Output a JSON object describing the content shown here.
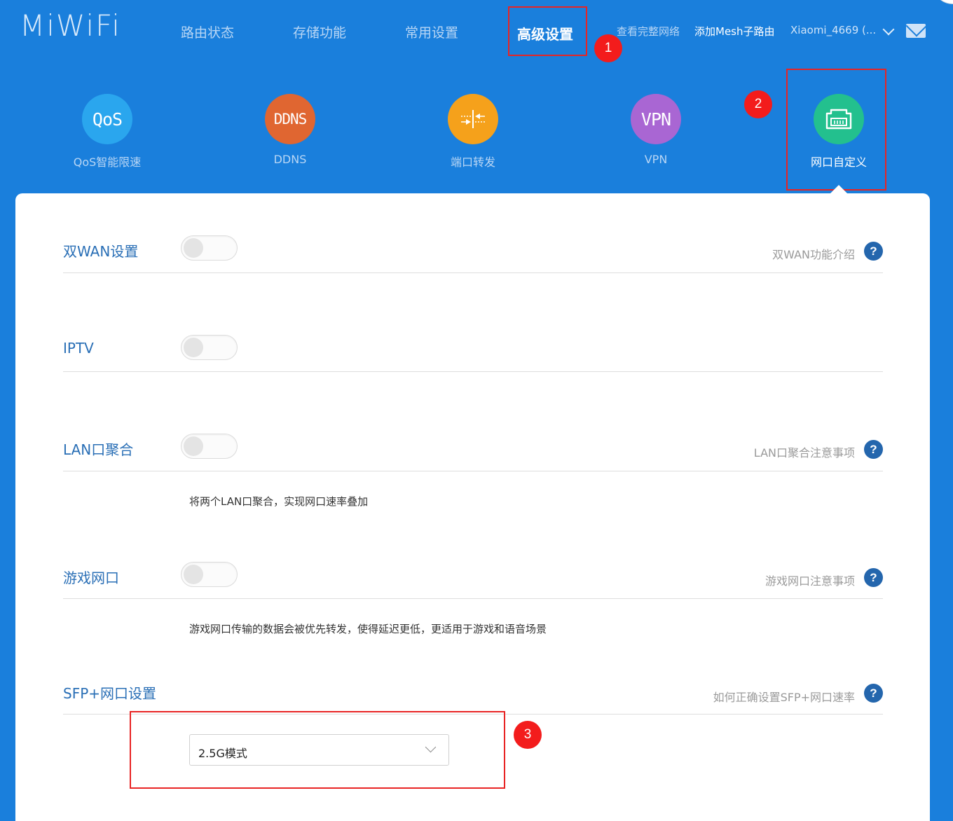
{
  "logo": "MiWiFi",
  "nav": {
    "items": [
      "路由状态",
      "存储功能",
      "常用设置",
      "高级设置"
    ],
    "active_index": 3,
    "view_network": "查看完整网络",
    "add_mesh": "添加Mesh子路由",
    "device_name": "Xiaomi_4669 (..."
  },
  "badges": [
    "1",
    "2",
    "3"
  ],
  "functions": [
    {
      "icon_text": "QoS",
      "label": "QoS智能限速",
      "color": "#2aa6ee",
      "icon": "qos-icon"
    },
    {
      "icon_text": "DDNS",
      "label": "DDNS",
      "color": "#e06631",
      "icon": "ddns-icon"
    },
    {
      "icon_text": "",
      "label": "端口转发",
      "color": "#f5a11b",
      "icon": "port-forward-icon"
    },
    {
      "icon_text": "VPN",
      "label": "VPN",
      "color": "#a966d3",
      "icon": "vpn-icon"
    },
    {
      "icon_text": "",
      "label": "网口自定义",
      "color": "#23c08e",
      "icon": "ethernet-port-icon",
      "active": true
    }
  ],
  "settings": {
    "dual_wan": {
      "title": "双WAN设置",
      "enabled": false,
      "help": "双WAN功能介绍"
    },
    "iptv": {
      "title": "IPTV",
      "enabled": false
    },
    "lan_agg": {
      "title": "LAN口聚合",
      "enabled": false,
      "help": "LAN口聚合注意事项",
      "desc": "将两个LAN口聚合，实现网口速率叠加"
    },
    "game_port": {
      "title": "游戏网口",
      "enabled": false,
      "help": "游戏网口注意事项",
      "desc": "游戏网口传输的数据会被优先转发，使得延迟更低，更适用于游戏和语音场景"
    },
    "sfp": {
      "title": "SFP+网口设置",
      "help": "如何正确设置SFP+网口速率",
      "selected": "2.5G模式"
    }
  },
  "help_symbol": "?"
}
